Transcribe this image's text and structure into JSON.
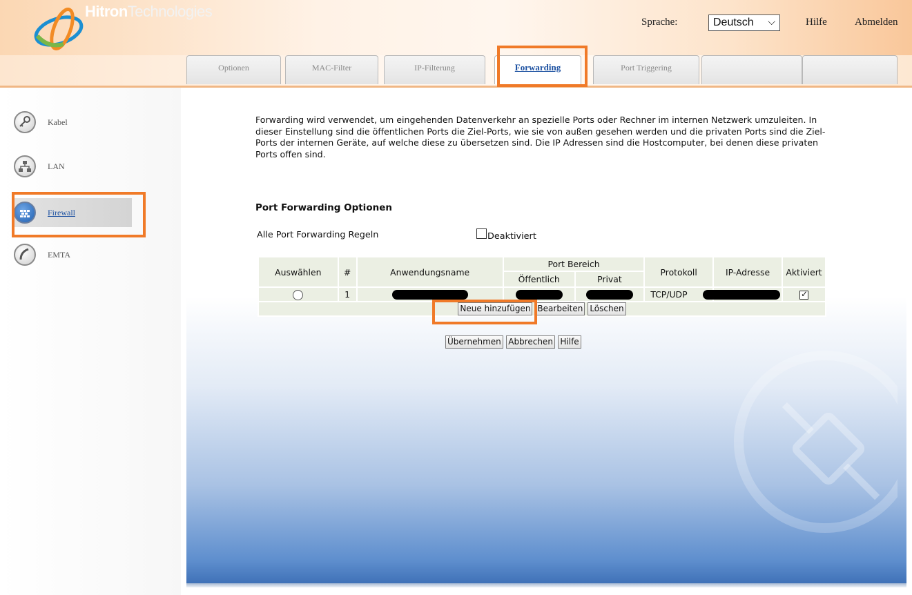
{
  "header": {
    "brand_bold": "Hitron",
    "brand_rest": "Technologies",
    "language_label": "Sprache:",
    "language_value": "Deutsch",
    "help_link": "Hilfe",
    "logout_link": "Abmelden"
  },
  "tabs": [
    {
      "label": "Optionen",
      "active": false
    },
    {
      "label": "MAC-Filter",
      "active": false
    },
    {
      "label": "IP-Filterung",
      "active": false
    },
    {
      "label": "Forwarding",
      "active": true
    },
    {
      "label": "Port Triggering",
      "active": false
    },
    {
      "label": "",
      "active": false
    },
    {
      "label": "",
      "active": false
    }
  ],
  "sidebar": {
    "items": [
      {
        "label": "Kabel",
        "icon": "key-icon",
        "active": false
      },
      {
        "label": "LAN",
        "icon": "network-icon",
        "active": false
      },
      {
        "label": "Firewall",
        "icon": "firewall-icon",
        "active": true
      },
      {
        "label": "EMTA",
        "icon": "phone-icon",
        "active": false
      }
    ]
  },
  "main": {
    "intro": "Forwarding wird verwendet, um eingehenden Datenverkehr an spezielle Ports oder Rechner im internen Netzwerk umzuleiten. In dieser Einstellung sind die öffentlichen Ports die Ziel-Ports, wie sie von außen gesehen werden und die privaten Ports sind die Ziel-Ports der internen Geräte, auf welche diese zu übersetzen sind. Die IP Adressen sind die Hostcomputer, bei denen diese privaten Ports offen sind.",
    "section_title": "Port Forwarding Optionen",
    "all_rules_label": "Alle Port Forwarding Regeln",
    "disabled_label": "Deaktiviert",
    "disabled_checked": false
  },
  "table": {
    "headers": {
      "select": "Auswählen",
      "number": "#",
      "app_name": "Anwendungsname",
      "port_range": "Port Bereich",
      "public": "Öffentlich",
      "private": "Privat",
      "protocol": "Protokoll",
      "ip": "IP-Adresse",
      "enabled": "Aktiviert"
    },
    "rows": [
      {
        "number": "1",
        "app_name": "[redacted]",
        "public": "[redacted]",
        "private": "[redacted]",
        "protocol": "TCP/UDP",
        "ip": "[redacted]",
        "enabled": true
      }
    ]
  },
  "buttons": {
    "add_new": "Neue hinzufügen",
    "edit": "Bearbeiten",
    "delete": "Löschen",
    "apply": "Übernehmen",
    "cancel": "Abbrechen",
    "help": "Hilfe"
  },
  "colors": {
    "highlight": "#f07a28",
    "active_tab_text": "#1a4fa0"
  }
}
